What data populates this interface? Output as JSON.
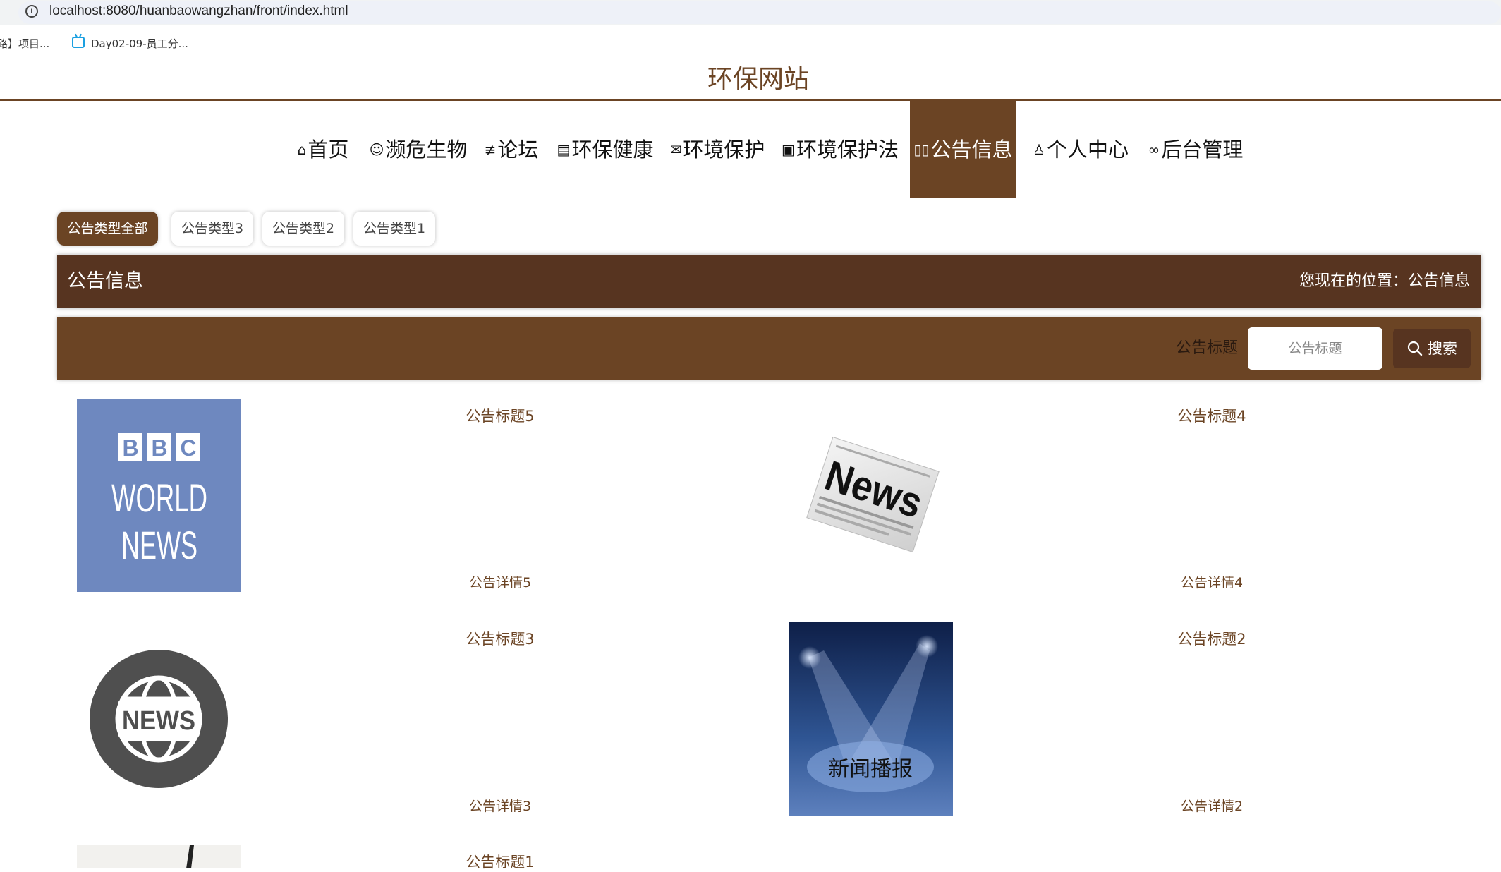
{
  "browser": {
    "url": "localhost:8080/huanbaowangzhan/front/index.html",
    "bookmarks": [
      {
        "label": "路】项目..."
      },
      {
        "label": "Day02-09-员工分..."
      }
    ]
  },
  "site": {
    "title": "环保网站"
  },
  "nav": {
    "items": [
      {
        "label": "首页",
        "icon": "home-icon"
      },
      {
        "label": "濒危生物",
        "icon": "smile-icon"
      },
      {
        "label": "论坛",
        "icon": "sliders-icon"
      },
      {
        "label": "环保健康",
        "icon": "clipboard-icon"
      },
      {
        "label": "环境保护",
        "icon": "mail-icon"
      },
      {
        "label": "环境保护法",
        "icon": "grid-icon"
      },
      {
        "label": "公告信息",
        "icon": "book-icon",
        "active": true
      },
      {
        "label": "个人中心",
        "icon": "user-icon"
      },
      {
        "label": "后台管理",
        "icon": "link-icon"
      }
    ]
  },
  "filters": {
    "tabs": [
      {
        "label": "公告类型全部",
        "active": true
      },
      {
        "label": "公告类型3"
      },
      {
        "label": "公告类型2"
      },
      {
        "label": "公告类型1"
      }
    ]
  },
  "banner": {
    "title": "公告信息",
    "location": "您现在的位置：公告信息"
  },
  "search": {
    "label": "公告标题",
    "placeholder": "公告标题",
    "button": "搜索"
  },
  "notices": [
    {
      "title": "公告标题5",
      "detail": "公告详情5",
      "image": "bbc-world-news"
    },
    {
      "title": "公告标题4",
      "detail": "公告详情4",
      "image": "newspaper"
    },
    {
      "title": "公告标题3",
      "detail": "公告详情3",
      "image": "news-globe"
    },
    {
      "title": "公告标题2",
      "detail": "公告详情2",
      "image": "news-broadcast",
      "image_text": "新闻播报"
    },
    {
      "title": "公告标题1",
      "detail": "",
      "image": "partial"
    }
  ],
  "thumb_text": {
    "bbc": "BBC",
    "world": "WORLD",
    "news": "NEWS",
    "news_paper": "News"
  },
  "colors": {
    "brand": "#6b4424",
    "brand_dark": "#573420"
  }
}
